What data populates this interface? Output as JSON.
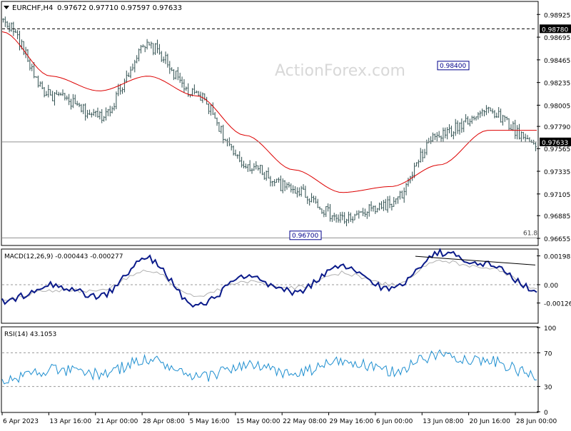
{
  "header": {
    "symbol": "EURCHF,H4",
    "ohlc": "0.97672 0.97710 0.97597 0.97633"
  },
  "watermark": "ActionForex.com",
  "chart_data": [
    {
      "type": "line",
      "panel": "price",
      "title": "EURCHF,H4",
      "subtitle": "0.97672 0.97710 0.97597 0.97633",
      "style": "bar (OHLC) chart",
      "ylim": [
        0.9659,
        0.9905
      ],
      "y_ticks": [
        "0.98925",
        "0.98695",
        "0.98465",
        "0.98235",
        "0.98005",
        "0.97790",
        "0.97565",
        "0.97335",
        "0.97105",
        "0.96885",
        "0.96655"
      ],
      "x_ticks": [
        "6 Apr 2023",
        "13 Apr 16:00",
        "21 Apr 00:00",
        "28 Apr 08:00",
        "5 May 16:00",
        "15 May 00:00",
        "22 May 08:00",
        "29 May 16:00",
        "6 Jun 00:00",
        "13 Jun 08:00",
        "20 Jun 16:00",
        "28 Jun 00:00"
      ],
      "series": [
        {
          "name": "",
          "color": "#2f4f4f",
          "x": [
            "6 Apr",
            "13 Apr",
            "21 Apr",
            "28 Apr",
            "5 May",
            "15 May",
            "22 May",
            "29 May",
            "6 Jun",
            "13 Jun",
            "20 Jun",
            "28 Jun"
          ],
          "values": [
            0.9885,
            0.981,
            0.979,
            0.986,
            0.981,
            0.974,
            0.9715,
            0.9685,
            0.97,
            0.977,
            0.9795,
            0.9763
          ]
        },
        {
          "name": "",
          "color": "#dd0000",
          "values": [
            0.9875,
            0.983,
            0.9815,
            0.983,
            0.981,
            0.977,
            0.9735,
            0.9712,
            0.9718,
            0.974,
            0.9775,
            0.9775
          ]
        }
      ],
      "levels": [
        {
          "label": "0.98780",
          "value": 0.9878,
          "style": "dashed"
        },
        {
          "label": "0.97633",
          "value": 0.97633,
          "style": "solid"
        },
        {
          "label": "61.8",
          "value": 0.9666,
          "style": "solid"
        }
      ],
      "annotations": [
        {
          "text": "0.98400",
          "value": 0.984
        },
        {
          "text": "0.96700",
          "value": 0.967
        }
      ]
    },
    {
      "type": "line",
      "panel": "macd",
      "title": "MACD(12,26,9) -0.000443 -0.000277",
      "ylim": [
        -0.0026,
        0.0024
      ],
      "y_ticks": [
        "0.00198",
        "0.00",
        "-0.00126"
      ],
      "series": [
        {
          "name": "",
          "color": "#0a1a8a",
          "values": [
            -0.0012,
            0.0,
            -0.0008,
            0.0018,
            -0.0015,
            0.0005,
            -0.0005,
            0.0012,
            -0.0003,
            0.0022,
            0.0014,
            -0.0004
          ]
        },
        {
          "name": "",
          "color": "#b0b0b0",
          "values": [
            -0.001,
            -0.0004,
            -0.0004,
            0.001,
            -0.0008,
            0.0002,
            -0.0002,
            0.0008,
            0.0,
            0.0016,
            0.0012,
            -0.0002
          ]
        }
      ],
      "trendline": {
        "from": 0.00195,
        "to": 0.00135
      }
    },
    {
      "type": "line",
      "panel": "rsi",
      "title": "RSI(14) 43.1053",
      "ylim": [
        0,
        100
      ],
      "y_ticks": [
        "100",
        "70",
        "30",
        "0"
      ],
      "levels": [
        70,
        30
      ],
      "series": [
        {
          "name": "",
          "color": "#1f8fd0",
          "values": [
            38,
            50,
            45,
            62,
            40,
            55,
            45,
            60,
            48,
            68,
            60,
            43.1053
          ]
        }
      ]
    }
  ]
}
